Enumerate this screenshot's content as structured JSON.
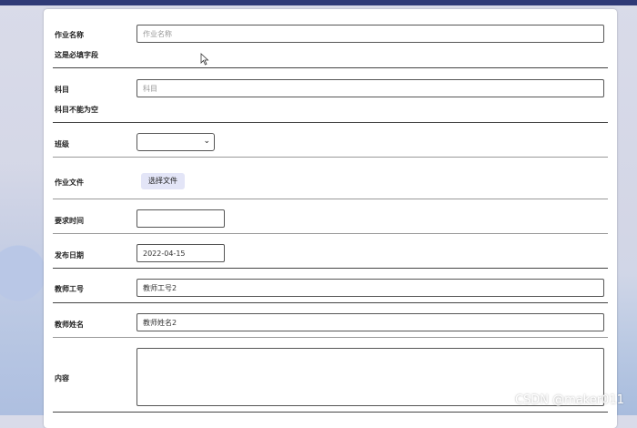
{
  "form": {
    "name": {
      "label": "作业名称",
      "placeholder": "作业名称",
      "hint": "这是必填字段"
    },
    "subject": {
      "label": "科目",
      "placeholder": "科目",
      "hint": "科目不能为空"
    },
    "class": {
      "label": "班级",
      "value": ""
    },
    "file": {
      "label": "作业文件",
      "button": "选择文件"
    },
    "due": {
      "label": "要求时间",
      "value": ""
    },
    "publish": {
      "label": "发布日期",
      "value": "2022-04-15"
    },
    "teacher_id": {
      "label": "教师工号",
      "value": "教师工号2"
    },
    "teacher_name": {
      "label": "教师姓名",
      "value": "教师姓名2"
    },
    "content": {
      "label": "内容",
      "value": ""
    }
  },
  "watermark": "CSDN @maker011",
  "colors": {
    "topbar": "#2f3a77",
    "file_button": "#e3e5f7"
  },
  "icons": {
    "select_arrow": "chevron-down-icon",
    "cursor": "mouse-pointer-icon"
  }
}
